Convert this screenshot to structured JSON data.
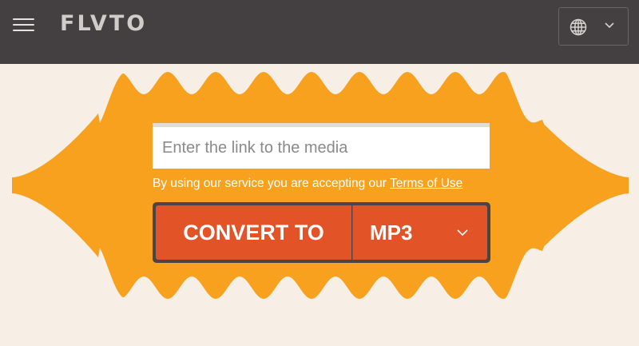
{
  "header": {
    "logo_text": "FLVTO",
    "menu_icon": "hamburger-menu-icon",
    "language_icon": "globe-icon",
    "language_dropdown_icon": "chevron-down-icon"
  },
  "converter": {
    "input_placeholder": "Enter the link to the media",
    "input_value": "",
    "terms_prefix": "By using our service you are accepting our ",
    "terms_link": "Terms of Use",
    "convert_label": "CONVERT TO",
    "format_selected": "MP3",
    "format_dropdown_icon": "chevron-down-icon"
  },
  "colors": {
    "header_bg": "#443f40",
    "page_bg": "#f7efe6",
    "wave_orange": "#f7a11f",
    "button_orange": "#e25327",
    "button_frame": "#4a4444"
  }
}
